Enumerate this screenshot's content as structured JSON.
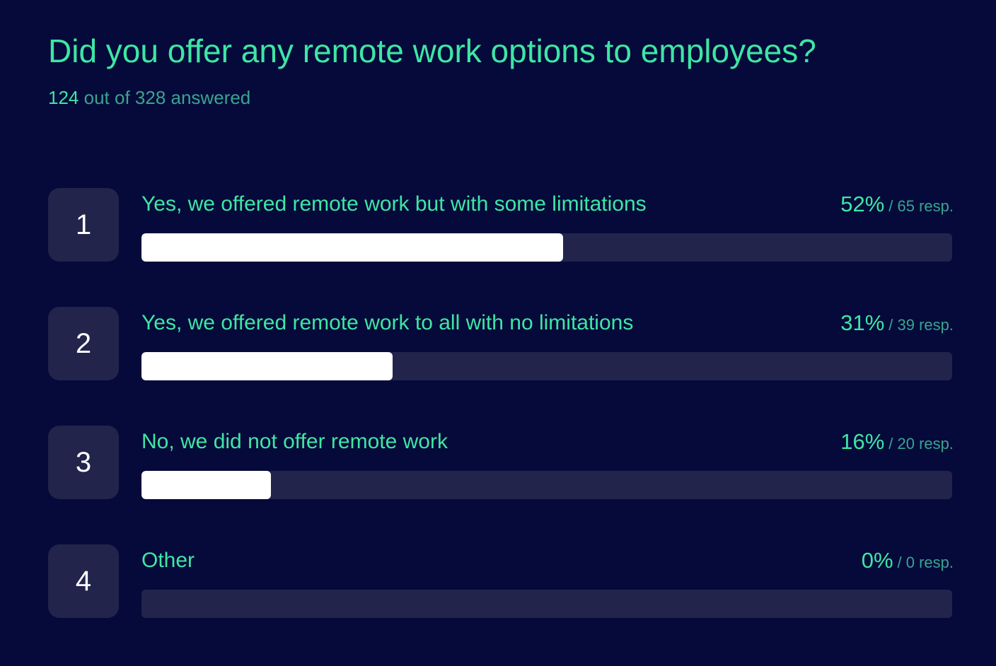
{
  "title": "Did you offer any remote work options to employees?",
  "subtitle": {
    "answered": "124",
    "rest": "out of 328 answered"
  },
  "colors": {
    "background": "#050a3a",
    "accent": "#3ee6a4",
    "muted_accent": "#3aa48e",
    "track": "#22244c",
    "fill": "#ffffff"
  },
  "chart_data": {
    "type": "bar",
    "orientation": "horizontal",
    "title": "Did you offer any remote work options to employees?",
    "categories": [
      "Yes, we offered remote work but with some limitations",
      "Yes, we offered remote work to all with no limitations",
      "No, we did not offer remote work",
      "Other"
    ],
    "values": [
      52,
      31,
      16,
      0
    ],
    "responses": [
      65,
      39,
      20,
      0
    ],
    "xlim": [
      0,
      100
    ]
  },
  "options": [
    {
      "number": "1",
      "label": "Yes, we offered remote work but with some limitations",
      "percent_text": "52%",
      "resp_text": "/ 65 resp."
    },
    {
      "number": "2",
      "label": "Yes, we offered remote work to all with no limitations",
      "percent_text": "31%",
      "resp_text": "/ 39 resp."
    },
    {
      "number": "3",
      "label": "No, we did not offer remote work",
      "percent_text": "16%",
      "resp_text": "/ 20 resp."
    },
    {
      "number": "4",
      "label": "Other",
      "percent_text": "0%",
      "resp_text": "/ 0 resp."
    }
  ]
}
